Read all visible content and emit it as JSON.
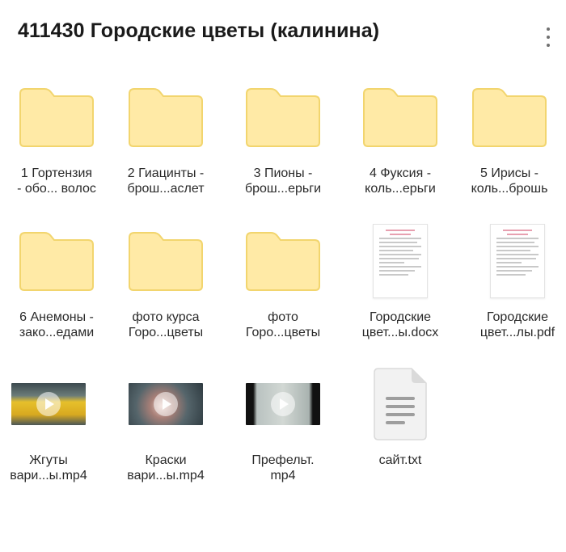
{
  "header": {
    "title": "411430 Городские цветы (калинина)",
    "menu_icon": "more-vertical-icon"
  },
  "colors": {
    "folder_fill": "#FFEAA6",
    "folder_stroke": "#F2D56E",
    "text": "#2a2a2a"
  },
  "items": [
    {
      "type": "folder",
      "line1": "1 Гортензия",
      "line2": "- обо... волос"
    },
    {
      "type": "folder",
      "line1": "2 Гиацинты -",
      "line2": "брош...аслет"
    },
    {
      "type": "folder",
      "line1": "3 Пионы -",
      "line2": "брош...ерьги"
    },
    {
      "type": "folder",
      "line1": "4 Фуксия -",
      "line2": "коль...ерьги"
    },
    {
      "type": "folder",
      "line1": "5 Ирисы -",
      "line2": "коль...брошь"
    },
    {
      "type": "folder",
      "line1": "6 Анемоны -",
      "line2": "зако...едами"
    },
    {
      "type": "folder",
      "line1": "фото курса",
      "line2": "Горо...цветы"
    },
    {
      "type": "folder",
      "line1": "фото",
      "line2": "Горо...цветы"
    },
    {
      "type": "document",
      "line1": "Городские",
      "line2": "цвет...ы.docx"
    },
    {
      "type": "document",
      "line1": "Городские",
      "line2": "цвет...лы.pdf"
    },
    {
      "type": "video",
      "line1": "Жгуты",
      "line2": "вари...ы.mp4"
    },
    {
      "type": "video",
      "line1": "Краски",
      "line2": "вари...ы.mp4"
    },
    {
      "type": "video",
      "line1": "Префельт.",
      "line2": "mp4"
    },
    {
      "type": "text-file",
      "line1": "сайт.txt",
      "line2": ""
    }
  ]
}
